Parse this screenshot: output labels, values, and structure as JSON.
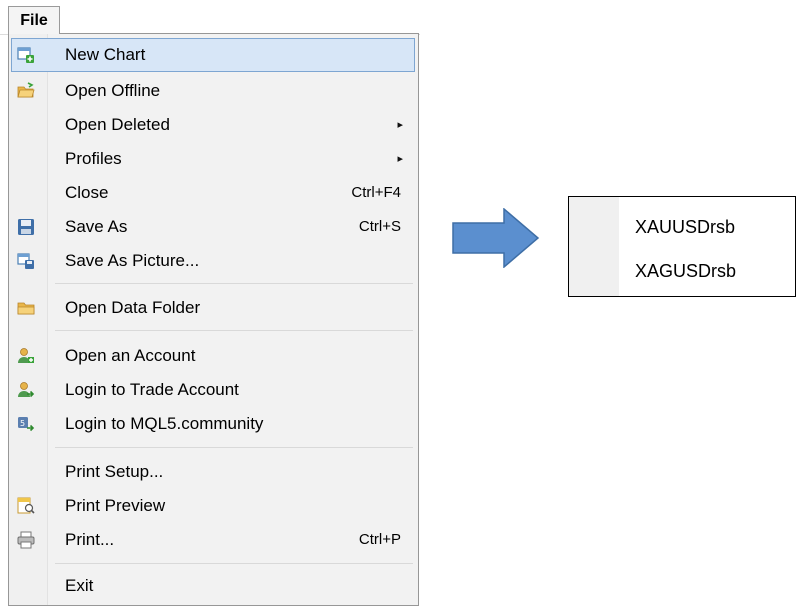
{
  "menubar": {
    "file_label": "File"
  },
  "menu": {
    "items": [
      {
        "label": "New Chart",
        "shortcut": "",
        "icon": "new-chart-icon"
      },
      {
        "label": "Open Offline",
        "shortcut": "",
        "icon": "open-folder-icon"
      },
      {
        "label": "Open Deleted",
        "shortcut": "",
        "submenu": true
      },
      {
        "label": "Profiles",
        "shortcut": "",
        "submenu": true
      },
      {
        "label": "Close",
        "shortcut": "Ctrl+F4"
      },
      {
        "label": "Save As",
        "shortcut": "Ctrl+S",
        "icon": "floppy-disk-icon"
      },
      {
        "label": "Save As Picture...",
        "shortcut": "",
        "icon": "save-picture-icon"
      },
      {
        "label": "Open Data Folder",
        "shortcut": "",
        "icon": "folder-icon"
      },
      {
        "label": "Open an Account",
        "shortcut": "",
        "icon": "user-add-icon"
      },
      {
        "label": "Login to Trade Account",
        "shortcut": "",
        "icon": "user-login-icon"
      },
      {
        "label": "Login to MQL5.community",
        "shortcut": "",
        "icon": "mql5-login-icon"
      },
      {
        "label": "Print Setup...",
        "shortcut": ""
      },
      {
        "label": "Print Preview",
        "shortcut": "",
        "icon": "print-preview-icon"
      },
      {
        "label": "Print...",
        "shortcut": "Ctrl+P",
        "icon": "printer-icon"
      },
      {
        "label": "Exit",
        "shortcut": ""
      }
    ]
  },
  "colors": {
    "highlight_bg": "#d7e6f7",
    "highlight_border": "#7ea6d2",
    "arrow": "#5b8fcf"
  },
  "symbols": [
    "XAUUSDrsb",
    "XAGUSDrsb"
  ]
}
